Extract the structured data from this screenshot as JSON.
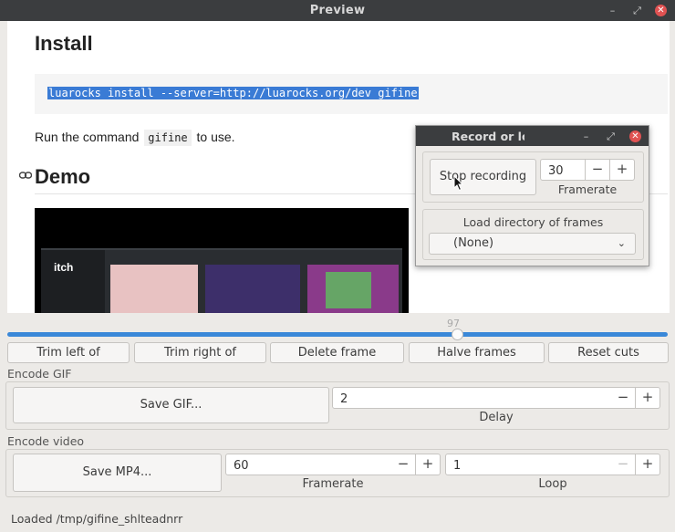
{
  "window": {
    "title": "Preview",
    "minimize": "–",
    "maximize": "⤢",
    "close": "✕"
  },
  "preview": {
    "install_heading": "Install",
    "install_command": "luarocks install --server=http://luarocks.org/dev gifine",
    "run_text_before": "Run the command",
    "run_code": "gifine",
    "run_text_after": "to use.",
    "demo_heading": "Demo",
    "demo_logo_text": "itch"
  },
  "slider": {
    "value": 97,
    "fraction": 0.675
  },
  "actions": {
    "trim_left": "Trim left of",
    "trim_right": "Trim right of",
    "delete_frame": "Delete frame",
    "halve_frames": "Halve frames",
    "reset_cuts": "Reset cuts"
  },
  "encode_gif": {
    "label": "Encode GIF",
    "save_button": "Save GIF...",
    "delay_value": "2",
    "delay_caption": "Delay"
  },
  "encode_video": {
    "label": "Encode video",
    "save_button": "Save MP4...",
    "framerate_value": "60",
    "framerate_caption": "Framerate",
    "loop_value": "1",
    "loop_caption": "Loop"
  },
  "stepper": {
    "minus": "−",
    "plus": "+"
  },
  "status": "Loaded /tmp/gifine_shlteadnrr",
  "dialog": {
    "title": "Record or loa",
    "stop_button": "Stop recording",
    "framerate_value": "30",
    "framerate_caption": "Framerate",
    "load_label": "Load directory of frames",
    "load_selected": "(None)"
  },
  "colors": {
    "accent": "#3a88d8",
    "titlebar": "#3b3d3f",
    "close": "#e05252"
  }
}
